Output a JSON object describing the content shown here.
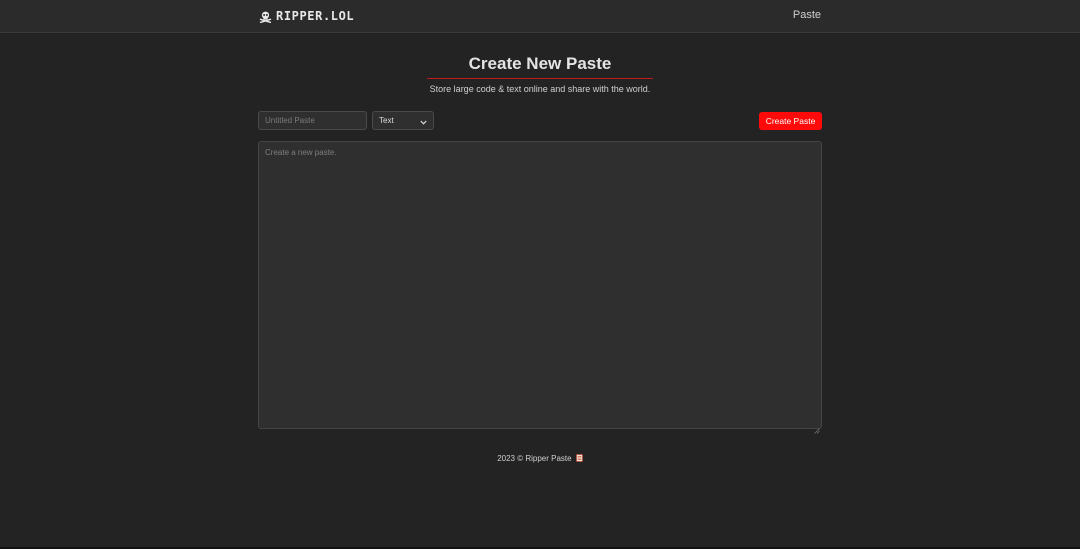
{
  "navbar": {
    "brand": "RIPPER.LOL",
    "brand_icon": "skull-crossbones-icon",
    "links": [
      "Paste"
    ]
  },
  "header": {
    "title": "Create New Paste",
    "subtitle": "Store large code & text online and share with the world."
  },
  "form": {
    "title_placeholder": "Untitled Paste",
    "title_value": "",
    "language_selected": "Text",
    "create_label": "Create Paste",
    "content_placeholder": "Create a new paste.",
    "content_value": ""
  },
  "footer": {
    "text": "2023 © Ripper Paste",
    "icon": "scroll-icon"
  },
  "colors": {
    "background": "#232323",
    "navbar": "#2b2b2b",
    "accent": "#ff0a0a",
    "underline": "#c21b1b",
    "field": "#2f2f2f"
  }
}
